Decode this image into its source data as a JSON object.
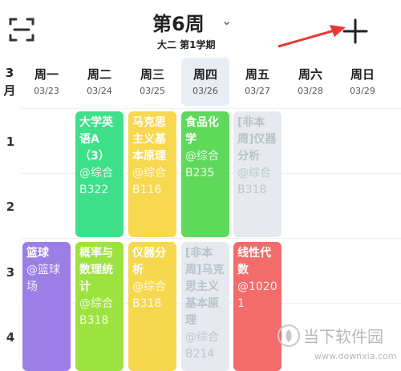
{
  "header": {
    "week_title": "第6周",
    "chevron": "⌄",
    "semester": "大二 第1学期",
    "scan_icon": "scan-icon",
    "add_icon": "plus-icon",
    "annotation_arrow_color": "#e53935"
  },
  "month": "3\n月",
  "days": [
    {
      "name": "周一",
      "date": "03/23",
      "today": false
    },
    {
      "name": "周二",
      "date": "03/24",
      "today": false
    },
    {
      "name": "周三",
      "date": "03/25",
      "today": false
    },
    {
      "name": "周四",
      "date": "03/26",
      "today": true
    },
    {
      "name": "周五",
      "date": "03/27",
      "today": false
    },
    {
      "name": "周六",
      "date": "03/28",
      "today": false
    },
    {
      "name": "周日",
      "date": "03/29",
      "today": false
    }
  ],
  "periods": [
    "1",
    "2",
    "3",
    "4"
  ],
  "courses": [
    {
      "name": "大学英语A（3）",
      "location": "@综合B322",
      "color": "#3ee08a",
      "muted": false
    },
    {
      "name": "马克思主义基本原理",
      "location": "@综合B116",
      "color": "#f7d84f",
      "muted": false
    },
    {
      "name": "食品化学",
      "location": "@综合B235",
      "color": "#5ed95a",
      "muted": false
    },
    {
      "name": "[非本周]仪器分析",
      "location": "@综合B318",
      "color": "#e6eaef",
      "muted": true
    },
    {
      "name": "篮球",
      "location": "@篮球场",
      "color": "#9b7fe6",
      "muted": false
    },
    {
      "name": "概率与数理统计",
      "location": "@综合B318",
      "color": "#9de33f",
      "muted": false
    },
    {
      "name": "仪器分析",
      "location": "@综合B318",
      "color": "#f6d84f",
      "muted": false
    },
    {
      "name": "[非本周]马克思主义基本原理",
      "location": "@综合B214",
      "color": "#e6eaef",
      "muted": true
    },
    {
      "name": "线性代数",
      "location": "@1020 1",
      "color": "#f36b6b",
      "muted": false
    }
  ],
  "watermark": {
    "text": "当下软件园",
    "url": "www.downxia.com"
  }
}
